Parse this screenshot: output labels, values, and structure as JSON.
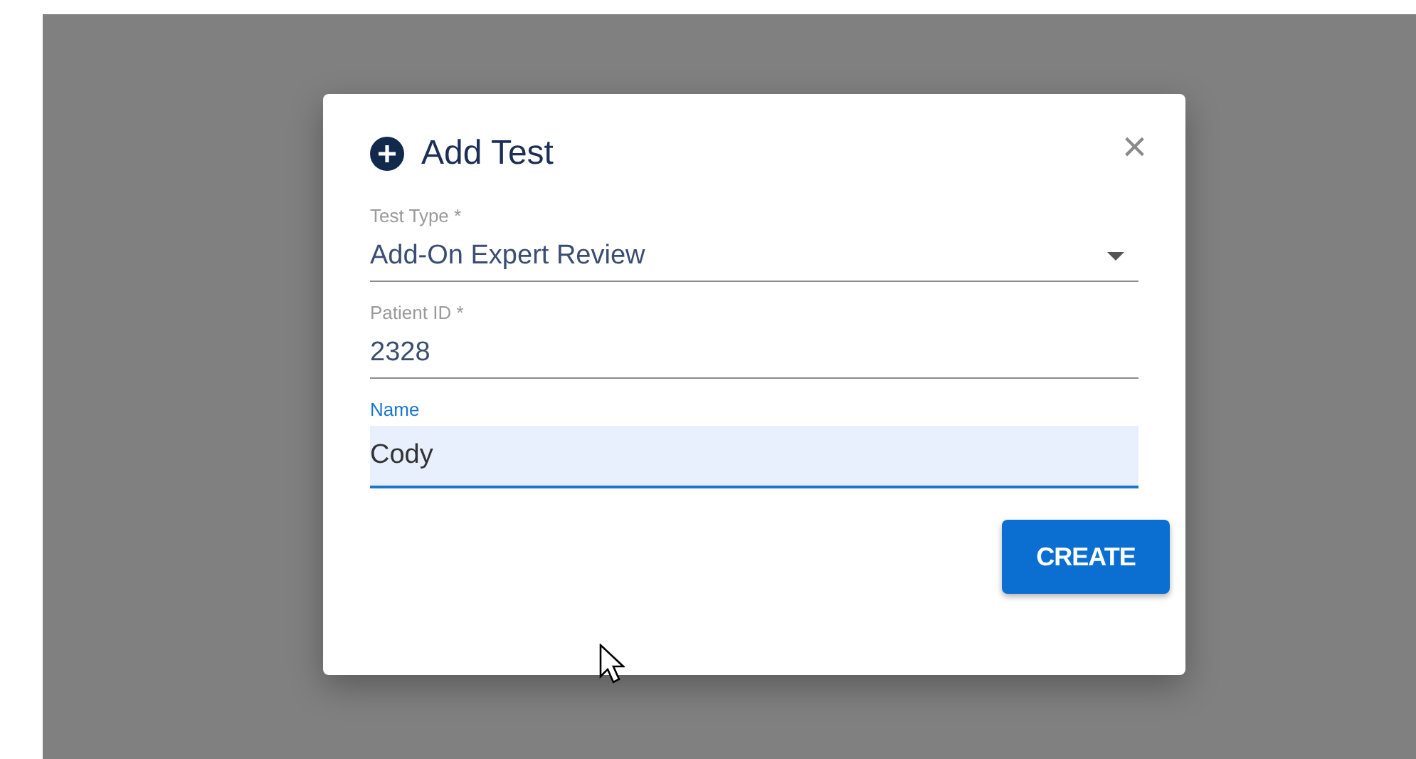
{
  "dialog": {
    "title": "Add Test",
    "close_label": "×",
    "fields": [
      {
        "kind": "select",
        "label": "Test Type *",
        "value": "Add-On Expert Review",
        "focused": false
      },
      {
        "kind": "text",
        "label": "Patient ID *",
        "value": "2328",
        "focused": false
      },
      {
        "kind": "text",
        "label": "Name",
        "value": "Cody",
        "focused": true
      }
    ],
    "buttons": [
      "CREATE"
    ]
  }
}
